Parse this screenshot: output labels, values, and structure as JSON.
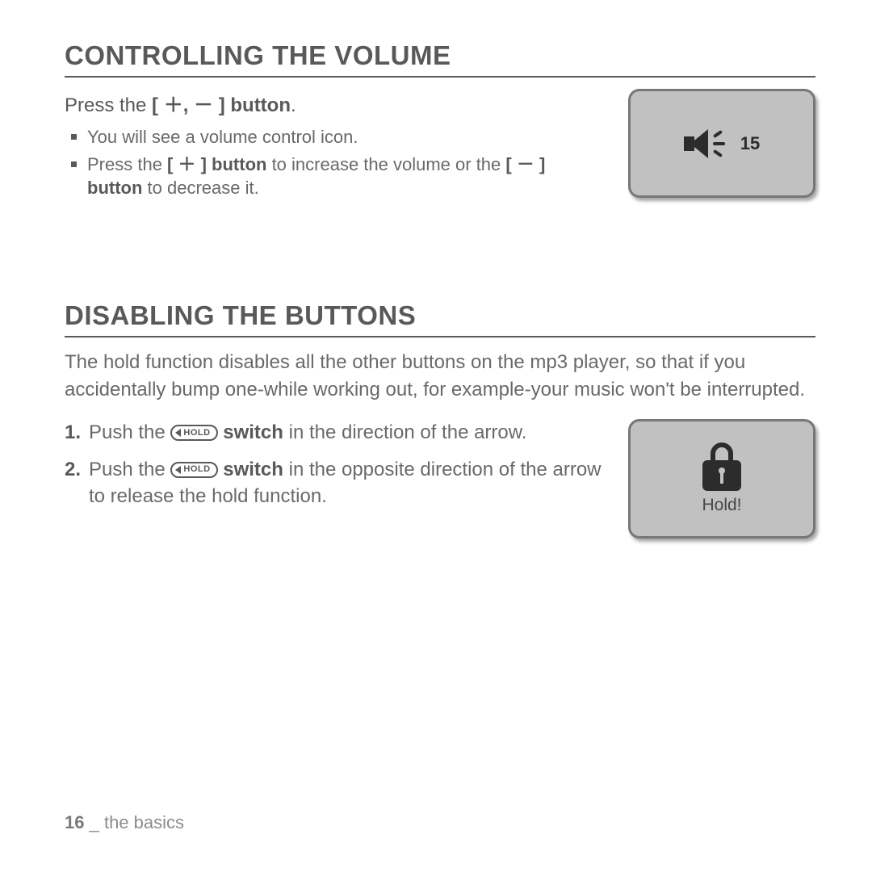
{
  "section1": {
    "title": "CONTROLLING THE VOLUME",
    "intro_prefix": "Press the ",
    "intro_buttons": "[ ＋, － ] button",
    "intro_suffix": ".",
    "bullet1": "You will see a volume control icon.",
    "bullet2_a": "Press the ",
    "bullet2_b": "[ ＋ ] button",
    "bullet2_c": " to increase the volume or the ",
    "bullet2_d": "[ － ] button",
    "bullet2_e": " to decrease it.",
    "volume_value": "15"
  },
  "section2": {
    "title": "DISABLING THE BUTTONS",
    "para": "The hold function disables all the other buttons on the mp3 player, so that if you accidentally bump one-while working out, for example-your music won't be interrupted.",
    "hold_label": "HOLD",
    "step1_a": "Push the ",
    "step1_b": " switch",
    "step1_c": " in the direction of the arrow.",
    "step2_a": "Push the ",
    "step2_b": " switch",
    "step2_c": " in the opposite direction of the arrow to release the hold function.",
    "lock_label": "Hold!"
  },
  "footer": {
    "page_number": "16",
    "separator": " _ ",
    "section_name": "the basics"
  }
}
